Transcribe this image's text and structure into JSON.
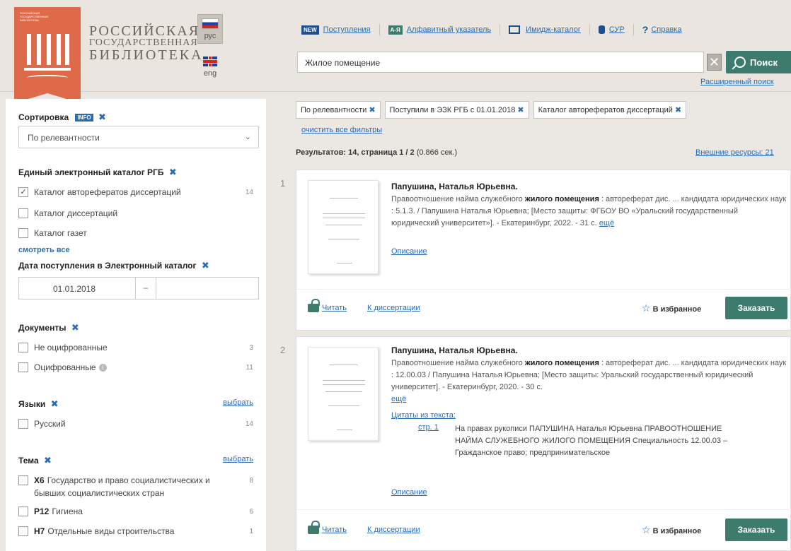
{
  "logo": {
    "small_text": "РОССИЙСКАЯ ГОСУДАРСТВЕННАЯ БИБЛИОТЕКА"
  },
  "brand": {
    "line1": "РОССИЙСКАЯ",
    "line2": "ГОСУДАРСТВЕННАЯ",
    "line3": "БИБЛИОТЕКА"
  },
  "lang": {
    "ru": "рус",
    "en": "eng"
  },
  "nav": {
    "new_badge": "NEW",
    "arrivals": "Поступления",
    "az_badge": "А-Я",
    "alphabet": "Алфавитный указатель",
    "image_catalog": "Имидж-каталог",
    "sur": "СУР",
    "help_mark": "?",
    "help": "Справка"
  },
  "search": {
    "value": "Жилое помещение",
    "clear": "✕",
    "button": "Поиск",
    "advanced": "Расширенный поиск"
  },
  "sidebar": {
    "sort_title": "Сортировка",
    "info_badge": "INFO",
    "sort_value": "По релевантности",
    "catalog_title": "Единый электронный каталог РГБ",
    "catalog_items": [
      {
        "label": "Каталог авторефератов диссертаций",
        "count": "14",
        "checked": "✓"
      },
      {
        "label": "Каталог диссертаций",
        "count": "",
        "checked": ""
      },
      {
        "label": "Каталог газет",
        "count": "",
        "checked": ""
      }
    ],
    "see_all": "смотреть все",
    "date_title": "Дата поступления в Электронный каталог",
    "date_from": "01.01.2018",
    "date_sep": "–",
    "docs_title": "Документы",
    "docs_items": [
      {
        "label": "Не оцифрованные",
        "count": "3"
      },
      {
        "label": "Оцифрованные",
        "count": "11"
      }
    ],
    "lang_title": "Языки",
    "choose": "выбрать",
    "lang_items": [
      {
        "label": "Русский",
        "count": "14"
      }
    ],
    "topic_title": "Тема",
    "topic_items": [
      {
        "code": "Х6",
        "label": "Государство и право социалистических и",
        "label2": "бывших социалистических стран",
        "count": "8"
      },
      {
        "code": "Р12",
        "label": "Гигиена",
        "count": "6"
      },
      {
        "code": "Н7",
        "label": "Отдельные виды строительства",
        "count": "1"
      }
    ]
  },
  "filters": {
    "chips": [
      "По релевантности",
      "Поступили в ЭЗК РГБ с 01.01.2018",
      "Каталог авторефератов диссертаций"
    ],
    "chip_x": "✖",
    "clear_all": "очистить все фильтры"
  },
  "results": {
    "summary_bold": "Результатов: 14, страница 1 / 2",
    "summary_time": "(0.866 сек.)",
    "external": "Внешние ресурсы: 21",
    "items": [
      {
        "num": "1",
        "author": "Папушина, Наталья Юрьевна.",
        "text_a": "Правоотношение найма служебного ",
        "text_bold": "жилого помещения",
        "text_b": " : автореферат дис. ... кандидата юридических наук : 5.1.3. / Папушина Наталья Юрьевна; [Место защиты: ФГБОУ ВО «Уральский государственный юридический университет»]. - Екатеринбург, 2022. - 31 с. ",
        "more": "ещё",
        "description": "Описание",
        "read": "Читать",
        "diss": "К диссертации",
        "fav": "В избранное",
        "order": "Заказать"
      },
      {
        "num": "2",
        "author": "Папушина, Наталья Юрьевна.",
        "text_a": "Правоотношение найма служебного ",
        "text_bold": "жилого помещения",
        "text_b": " : автореферат дис. ... кандидата юридических наук : 12.00.03 / Папушина Наталья Юрьевна; [Место защиты: Уральский государственный юридический университет]. - Екатеринбург, 2020. - 30 с.",
        "more": "ещё",
        "cite_label": "Цитаты из текста:",
        "cite_page": "стр. 1",
        "cite_text": "На правах рукописи ПАПУШИНА Наталья Юрьевна ПРАВООТНОШЕНИЕ НАЙМА СЛУЖЕБНОГО ЖИЛОГО ПОМЕЩЕНИЯ Специальность 12.00.03 – Гражданское право; предпринимательское",
        "description": "Описание",
        "read": "Читать",
        "diss": "К диссертации",
        "fav": "В избранное",
        "order": "Заказать"
      }
    ]
  },
  "icons": {
    "star": "☆",
    "chevron": "⌄",
    "x": "✖",
    "info": "i"
  },
  "colors": {
    "accent_green": "#3d7b6f",
    "brand_red": "#de6a4a",
    "link_blue": "#2a6cb4",
    "nav_blue": "#1f4e8c"
  }
}
